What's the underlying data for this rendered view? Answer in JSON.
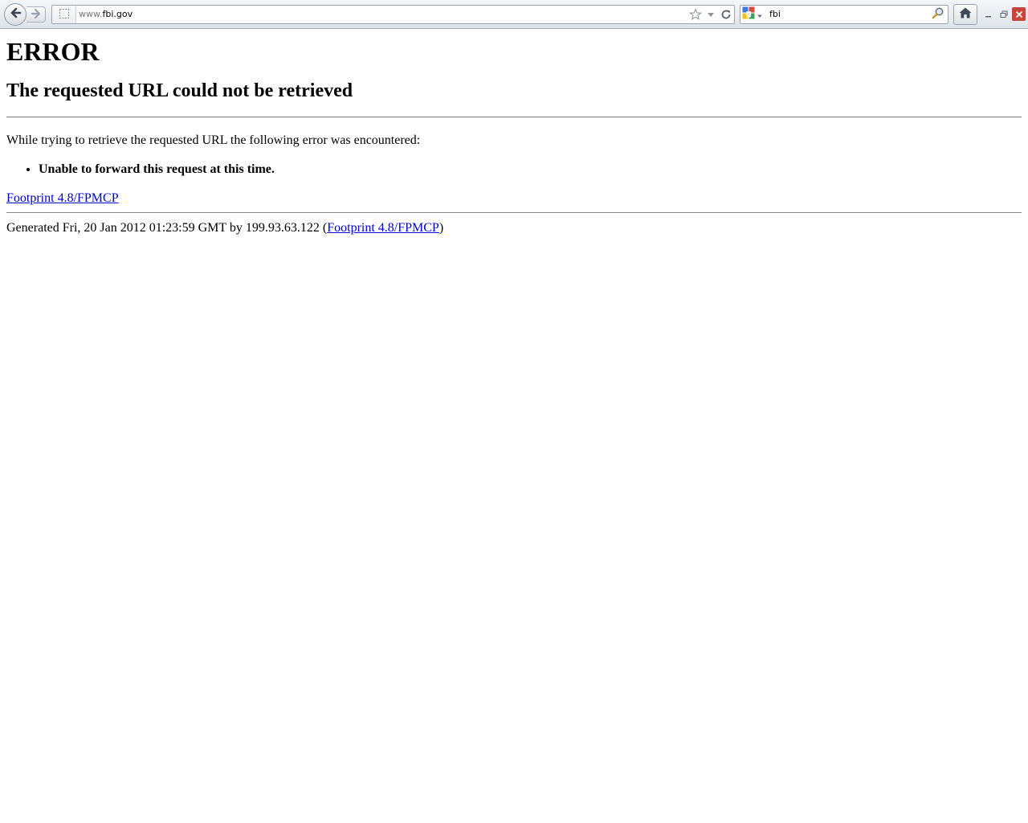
{
  "browser": {
    "url": {
      "prefix": "www.",
      "host": "fbi.gov"
    },
    "search": {
      "value": "fbi"
    },
    "icons": {
      "back": "back-arrow-icon",
      "forward": "forward-arrow-icon",
      "site_identity": "site-identity-icon",
      "bookmark": "star-icon",
      "history_dropdown": "chevron-down-icon",
      "reload": "reload-icon",
      "search_engine": "google-icon",
      "search_go": "magnifier-icon",
      "home": "home-icon",
      "minimize": "minimize-icon",
      "restore": "restore-icon",
      "close": "close-icon"
    }
  },
  "page": {
    "title": "ERROR",
    "subtitle": "The requested URL could not be retrieved",
    "intro": "While trying to retrieve the requested URL the following error was encountered:",
    "errors": [
      "Unable to forward this request at this time."
    ],
    "signature_link": "Footprint 4.8/FPMCP",
    "generated_prefix": "Generated Fri, 20 Jan 2012 01:23:59 GMT by 199.93.63.122 (",
    "generated_link": "Footprint 4.8/FPMCP",
    "generated_suffix": ")"
  },
  "colors": {
    "link": "#0000cc",
    "toolbar_top": "#f4f6f9",
    "toolbar_bottom": "#dfe4ea",
    "close_button": "#c7463a"
  }
}
